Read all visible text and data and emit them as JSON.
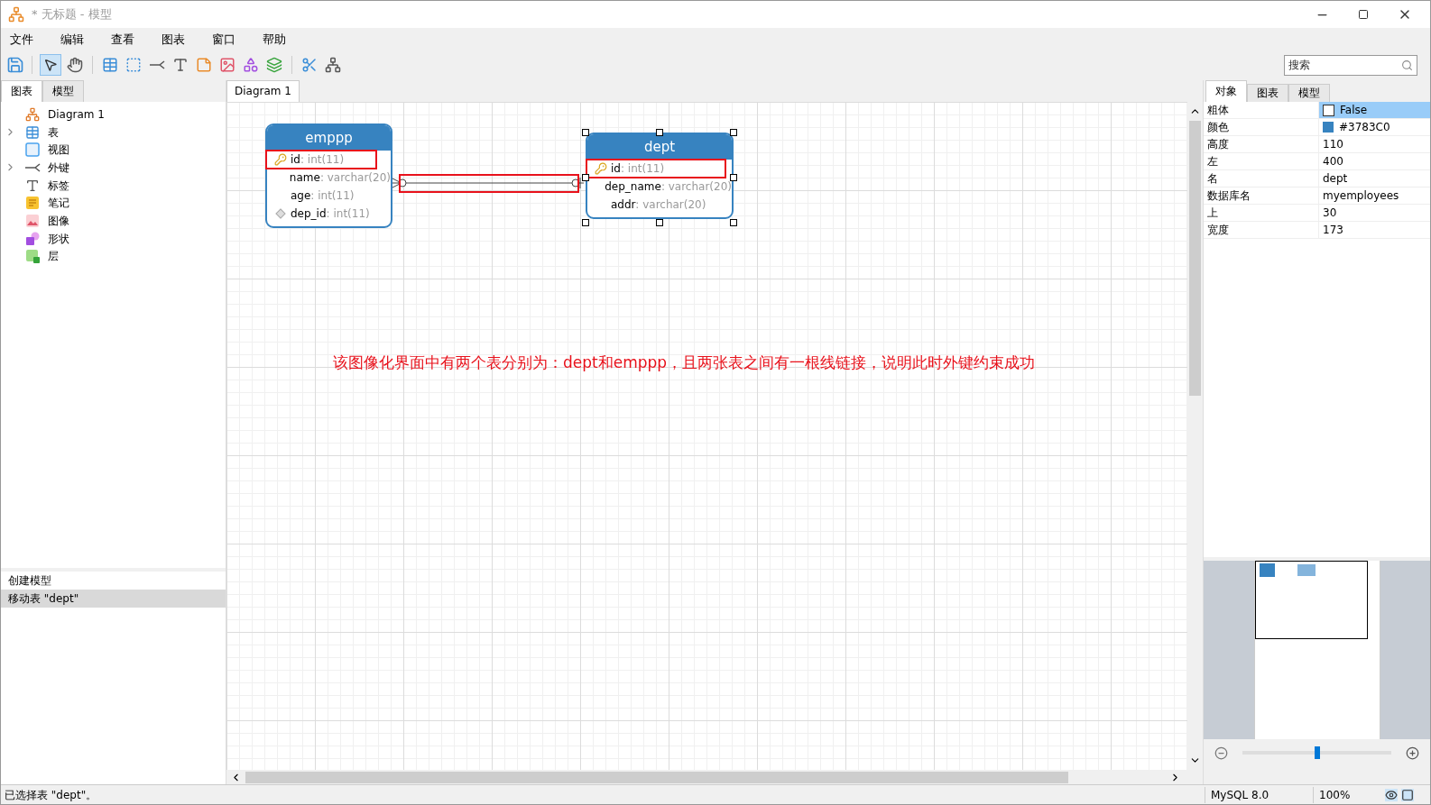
{
  "window": {
    "title": "* 无标题 - 模型"
  },
  "menu": [
    "文件",
    "编辑",
    "查看",
    "图表",
    "窗口",
    "帮助"
  ],
  "toolbar": {
    "pointer_selected": true
  },
  "search": {
    "placeholder": "搜索"
  },
  "left_panel": {
    "tabs": [
      {
        "label": "图表",
        "selected": true
      },
      {
        "label": "模型",
        "selected": false
      }
    ],
    "tree": [
      {
        "label": "Diagram 1",
        "kind": "diagram",
        "expandable": false
      },
      {
        "label": "表",
        "kind": "table",
        "expandable": true
      },
      {
        "label": "视图",
        "kind": "view",
        "expandable": false
      },
      {
        "label": "外键",
        "kind": "foreignkey",
        "expandable": true
      },
      {
        "label": "标签",
        "kind": "label",
        "expandable": false
      },
      {
        "label": "笔记",
        "kind": "note",
        "expandable": false
      },
      {
        "label": "图像",
        "kind": "image",
        "expandable": false
      },
      {
        "label": "形状",
        "kind": "shape",
        "expandable": false
      },
      {
        "label": "层",
        "kind": "layer",
        "expandable": false
      }
    ],
    "history": [
      {
        "label": "创建模型",
        "selected": false
      },
      {
        "label": "移动表 \"dept\"",
        "selected": true
      }
    ]
  },
  "diagram_tab": {
    "label": "Diagram 1"
  },
  "canvas": {
    "tables": [
      {
        "name": "emppp",
        "selected": false,
        "columns": [
          {
            "name": "id",
            "type": ": int(11)",
            "kind": "primary",
            "highlighted": true
          },
          {
            "name": "name",
            "type": ": varchar(20)",
            "kind": "plain",
            "highlighted": false
          },
          {
            "name": "age",
            "type": ": int(11)",
            "kind": "plain",
            "highlighted": false
          },
          {
            "name": "dep_id",
            "type": ": int(11)",
            "kind": "foreign",
            "highlighted": false
          }
        ]
      },
      {
        "name": "dept",
        "selected": true,
        "columns": [
          {
            "name": "id",
            "type": ": int(11)",
            "kind": "primary",
            "highlighted": true
          },
          {
            "name": "dep_name",
            "type": ": varchar(20)",
            "kind": "plain",
            "highlighted": false
          },
          {
            "name": "addr",
            "type": ": varchar(20)",
            "kind": "plain",
            "highlighted": false
          }
        ]
      }
    ],
    "link_highlighted": true,
    "annotation": "该图像化界面中有两个表分别为：dept和emppp，且两张表之间有一根线链接，说明此时外键约束成功"
  },
  "properties": {
    "tabs": [
      {
        "label": "对象",
        "selected": true
      },
      {
        "label": "图表",
        "selected": false
      },
      {
        "label": "模型",
        "selected": false
      }
    ],
    "rows": [
      {
        "name": "粗体",
        "value": "False",
        "kind": "checkbox",
        "checked": false,
        "selected": true
      },
      {
        "name": "颜色",
        "value": "#3783C0",
        "kind": "color",
        "color": "#3783c0",
        "selected": false
      },
      {
        "name": "高度",
        "value": "110",
        "kind": "text",
        "selected": false
      },
      {
        "name": "左",
        "value": "400",
        "kind": "text",
        "selected": false
      },
      {
        "name": "名",
        "value": "dept",
        "kind": "text",
        "selected": false
      },
      {
        "name": "数据库名",
        "value": "myemployees",
        "kind": "text",
        "selected": false
      },
      {
        "name": "上",
        "value": "30",
        "kind": "text",
        "selected": false
      },
      {
        "name": "宽度",
        "value": "173",
        "kind": "text",
        "selected": false
      }
    ]
  },
  "zoom": {
    "level": 0.5
  },
  "status_bar": {
    "message": "已选择表 \"dept\"。",
    "server": "MySQL 8.0",
    "zoom": "100%"
  }
}
